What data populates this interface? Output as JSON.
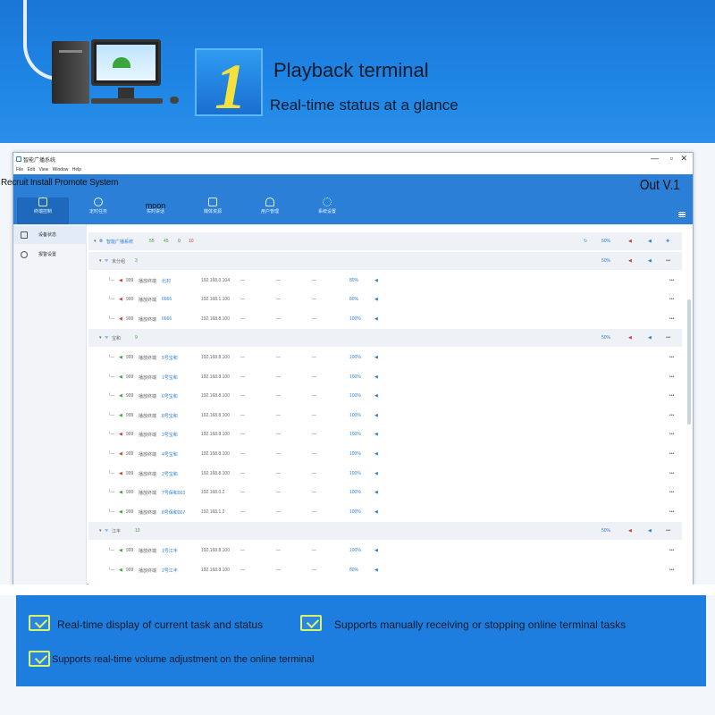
{
  "banner": {
    "number": "1",
    "title": "Playback terminal",
    "subtitle": "Real-time status at a glance"
  },
  "window": {
    "title": "智能广播系统",
    "menu": [
      "File",
      "Edit",
      "View",
      "Window",
      "Help"
    ],
    "controls": [
      "—",
      "▫",
      "✕"
    ],
    "app_title": "Recruit Install Promote System",
    "version": "Out V.1",
    "toolbar": [
      {
        "label": "终端控制",
        "icon": "terminal-icon"
      },
      {
        "label": "定时任务",
        "icon": "clock-icon"
      },
      {
        "label": "实时讲话",
        "overlay": "moon",
        "icon": "microphone-icon"
      },
      {
        "label": "媒体资源",
        "icon": "media-icon"
      },
      {
        "label": "用户管理",
        "icon": "user-icon"
      },
      {
        "label": "系统设置",
        "icon": "gear-icon"
      }
    ],
    "sidebar": [
      {
        "label": "设备状态",
        "icon": "speaker-icon"
      },
      {
        "label": "报警设置",
        "icon": "alarm-icon"
      }
    ],
    "root_group": {
      "name": "智能广播系统",
      "total": "55",
      "online": "45",
      "muted": "0",
      "offline": "10",
      "volume": "50%"
    },
    "groups": [
      {
        "name": "未分组",
        "count": "3",
        "volume": "50%",
        "rows": [
          {
            "id": "999",
            "type": "播放终端",
            "name": "北村",
            "ip": "192.168.0.104",
            "d1": "—",
            "d2": "—",
            "d3": "—",
            "volume": "80%",
            "state": "red"
          },
          {
            "id": "999",
            "type": "播放终端",
            "name": "6666",
            "ip": "192.168.1.100",
            "d1": "—",
            "d2": "—",
            "d3": "—",
            "volume": "80%",
            "state": "red"
          },
          {
            "id": "999",
            "type": "播放终端",
            "name": "6666",
            "ip": "192.168.8.100",
            "d1": "—",
            "d2": "—",
            "d3": "—",
            "volume": "100%",
            "state": "red"
          }
        ]
      },
      {
        "name": "宝和",
        "count": "9",
        "volume": "50%",
        "rows": [
          {
            "id": "999",
            "type": "播放终端",
            "name": "5号宝和",
            "ip": "192.168.8.100",
            "d1": "—",
            "d2": "—",
            "d3": "—",
            "volume": "100%",
            "state": "green"
          },
          {
            "id": "999",
            "type": "播放终端",
            "name": "1号宝和",
            "ip": "192.168.8.100",
            "d1": "—",
            "d2": "—",
            "d3": "—",
            "volume": "100%",
            "state": "green"
          },
          {
            "id": "999",
            "type": "播放终端",
            "name": "6号宝和",
            "ip": "192.168.8.100",
            "d1": "—",
            "d2": "—",
            "d3": "—",
            "volume": "100%",
            "state": "green"
          },
          {
            "id": "999",
            "type": "播放终端",
            "name": "8号宝和",
            "ip": "192.168.8.100",
            "d1": "—",
            "d2": "—",
            "d3": "—",
            "volume": "100%",
            "state": "green"
          },
          {
            "id": "999",
            "type": "播放终端",
            "name": "3号宝和",
            "ip": "192.168.8.100",
            "d1": "—",
            "d2": "—",
            "d3": "—",
            "volume": "100%",
            "state": "red"
          },
          {
            "id": "999",
            "type": "播放终端",
            "name": "4号宝和",
            "ip": "192.168.8.100",
            "d1": "—",
            "d2": "—",
            "d3": "—",
            "volume": "100%",
            "state": "red"
          },
          {
            "id": "999",
            "type": "播放终端",
            "name": "2号宝和",
            "ip": "192.168.8.100",
            "d1": "—",
            "d2": "—",
            "d3": "—",
            "volume": "100%",
            "state": "red"
          },
          {
            "id": "999",
            "type": "播放终端",
            "name": "7号保和003",
            "ip": "192.168.0.2",
            "d1": "—",
            "d2": "—",
            "d3": "—",
            "volume": "100%",
            "state": "green"
          },
          {
            "id": "999",
            "type": "播放终端",
            "name": "8号保和007",
            "ip": "192.168.1.2",
            "d1": "—",
            "d2": "—",
            "d3": "—",
            "volume": "100%",
            "state": "green"
          }
        ]
      },
      {
        "name": "江丰",
        "count": "10",
        "volume": "50%",
        "rows": [
          {
            "id": "999",
            "type": "播放终端",
            "name": "1号江丰",
            "ip": "192.168.8.100",
            "d1": "—",
            "d2": "—",
            "d3": "—",
            "volume": "100%",
            "state": "green"
          },
          {
            "id": "999",
            "type": "播放终端",
            "name": "2号江丰",
            "ip": "192.168.8.100",
            "d1": "—",
            "d2": "—",
            "d3": "—",
            "volume": "80%",
            "state": "green"
          }
        ]
      }
    ],
    "more": "•••"
  },
  "features": [
    "Real-time display of current task and status",
    "Supports manually receiving or stopping online terminal tasks",
    "Supports real-time volume adjustment on the online terminal"
  ],
  "colors": {
    "banner": "#1f86e6",
    "accent_yellow": "#f4e23a",
    "toolbar": "#2b7fd6",
    "online": "#3aa53a",
    "offline": "#d23a3a"
  }
}
